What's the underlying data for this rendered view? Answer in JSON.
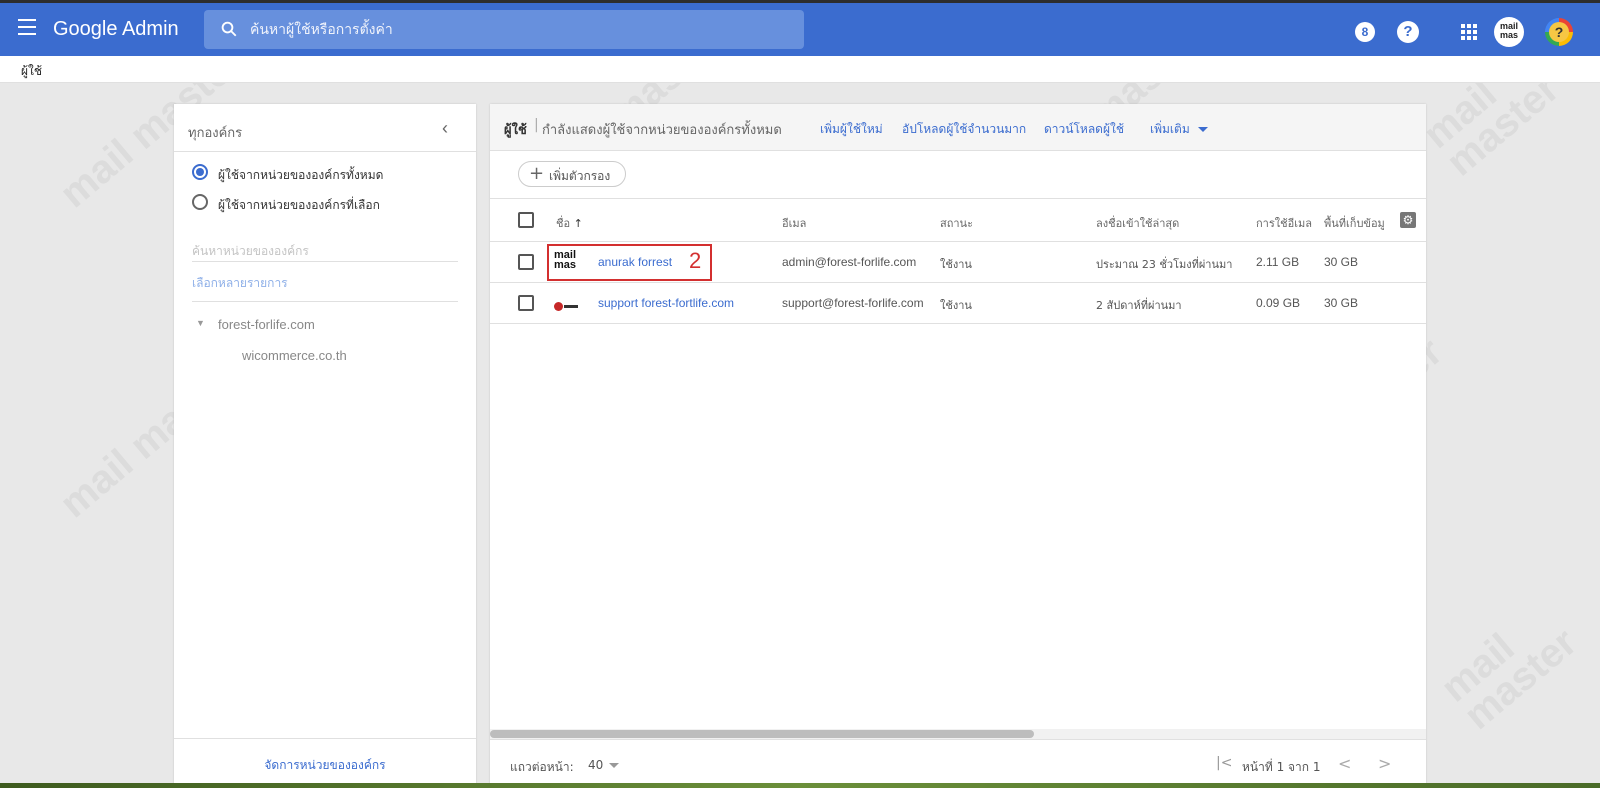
{
  "topbar": {
    "app_title": "Google Admin",
    "search_placeholder": "ค้นหาผู้ใช้หรือการตั้งค่า",
    "notification_count": "8",
    "help_label": "?",
    "account_logo_text": "mail mas",
    "avatar_symbol": "?"
  },
  "breadcrumb": {
    "label": "ผู้ใช้"
  },
  "sidebar": {
    "title": "ทุกองค์กร",
    "collapse_symbol": "‹",
    "options": [
      {
        "label": "ผู้ใช้จากหน่วยขององค์กรทั้งหมด",
        "selected": true
      },
      {
        "label": "ผู้ใช้จากหน่วยขององค์กรที่เลือก",
        "selected": false
      }
    ],
    "org_search_placeholder": "ค้นหาหน่วยขององค์กร",
    "multi_select_label": "เลือกหลายรายการ",
    "tree": {
      "root": "forest-forlife.com",
      "children": [
        "wicommerce.co.th"
      ]
    },
    "manage_label": "จัดการหน่วยขององค์กร"
  },
  "toolbar": {
    "title": "ผู้ใช้",
    "separator": "|",
    "description": "กำลังแสดงผู้ใช้จากหน่วยขององค์กรทั้งหมด",
    "add_user": "เพิ่มผู้ใช้ใหม่",
    "bulk_upload": "อัปโหลดผู้ใช้จำนวนมาก",
    "download_users": "ดาวน์โหลดผู้ใช้",
    "more": "เพิ่มเติม"
  },
  "filter": {
    "label": "เพิ่มตัวกรอง",
    "plus": "+"
  },
  "table": {
    "headers": {
      "name": "ชื่อ",
      "sort_arrow": "↑",
      "email": "อีเมล",
      "status": "สถานะ",
      "last_login": "ลงชื่อเข้าใช้ล่าสุด",
      "email_usage": "การใช้อีเมล",
      "storage": "พื้นที่เก็บข้อมู"
    },
    "rows": [
      {
        "name": "anurak forrest",
        "email": "admin@forest-forlife.com",
        "status": "ใช้งาน",
        "last_login": "ประมาณ 23 ชั่วโมงที่ผ่านมา",
        "email_usage": "2.11 GB",
        "storage": "30 GB"
      },
      {
        "name": "support forest-fortlife.com",
        "email": "support@forest-forlife.com",
        "status": "ใช้งาน",
        "last_login": "2 สัปดาห์ที่ผ่านมา",
        "email_usage": "0.09 GB",
        "storage": "30 GB"
      }
    ],
    "row1_logo_text": "mail mas",
    "annotation_number": "2"
  },
  "footer": {
    "rows_per_page_label": "แถวต่อหน้า:",
    "rows_per_page_value": "40",
    "page_info": "หน้าที่ 1 จาก 1",
    "first_symbol": "|<",
    "prev_symbol": "<",
    "next_symbol": ">"
  },
  "watermark": "mail master",
  "colors": {
    "header_blue": "#3b6ccf",
    "link_blue": "#3b6ccf",
    "highlight_red": "#d32f2f"
  }
}
